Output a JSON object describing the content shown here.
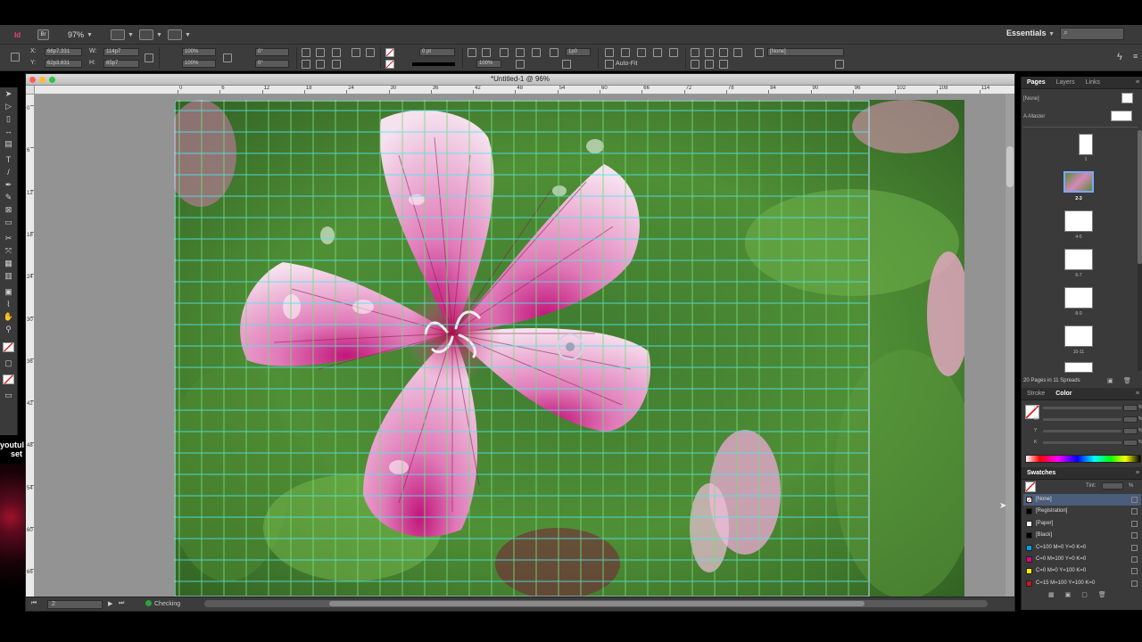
{
  "appbar": {
    "logo": "Id",
    "bridge": "Br",
    "zoom": "97%",
    "workspace": "Essentials"
  },
  "control": {
    "x_label": "X:",
    "x_value": "66p7.331",
    "y_label": "Y:",
    "y_value": "62p3.831",
    "w_label": "W:",
    "w_value": "114p7",
    "h_label": "H:",
    "h_value": "85p7",
    "scale_x": "100%",
    "scale_y": "100%",
    "rotate": "0°",
    "shear": "0°",
    "stroke_weight": "0 pt",
    "opacity": "100%",
    "gap": "1p0",
    "object_style": "[None]",
    "autofit": "Auto-Fit"
  },
  "document": {
    "title": "*Untitled-1 @ 96%",
    "page": "2",
    "preflight": "Checking"
  },
  "ruler": {
    "h_labels": [
      "0",
      "6",
      "12",
      "18",
      "24",
      "30",
      "36",
      "42",
      "48",
      "54",
      "60",
      "66",
      "72",
      "78",
      "84",
      "90",
      "96",
      "102",
      "108",
      "114"
    ],
    "v_labels": [
      "0",
      "6",
      "12",
      "18",
      "24",
      "30",
      "36",
      "42",
      "48",
      "54",
      "60",
      "66",
      "72"
    ]
  },
  "background": {
    "text_line1": "youtul",
    "text_line2": "set"
  },
  "pages_panel": {
    "tabs": [
      "Pages",
      "Layers",
      "Links"
    ],
    "none_label": "[None]",
    "master_label": "A-Master",
    "spreads": [
      "1",
      "2-3",
      "4-5",
      "6-7",
      "8-9",
      "10-11"
    ],
    "info": "20 Pages in 11 Spreads"
  },
  "color_panel": {
    "tabs": [
      "Stroke",
      "Color"
    ],
    "channels": [
      "C",
      "M",
      "Y",
      "K"
    ],
    "unit": "%"
  },
  "swatches_panel": {
    "title": "Swatches",
    "tint_label": "Tint:",
    "tint_unit": "%",
    "items": [
      {
        "name": "[None]",
        "color": "#ffffff"
      },
      {
        "name": "[Registration]",
        "color": "#000000"
      },
      {
        "name": "[Paper]",
        "color": "#ffffff"
      },
      {
        "name": "[Black]",
        "color": "#000000"
      },
      {
        "name": "C=100 M=0 Y=0 K=0",
        "color": "#00a0e9"
      },
      {
        "name": "C=0 M=100 Y=0 K=0",
        "color": "#e4007f"
      },
      {
        "name": "C=0 M=0 Y=100 K=0",
        "color": "#fff100"
      },
      {
        "name": "C=15 M=100 Y=100 K=0",
        "color": "#c8161d"
      }
    ]
  },
  "colors": {
    "guide": "#4fe6ef",
    "frame": "#7dd87a",
    "panel_bg": "#3a3a3a"
  },
  "icons": {
    "selection": "selection-arrow-icon",
    "direct": "direct-selection-icon",
    "text": "text-tool-icon",
    "pen": "pen-tool-icon",
    "rectangle": "rectangle-frame-icon",
    "hand": "hand-icon",
    "zoom": "zoom-icon"
  }
}
